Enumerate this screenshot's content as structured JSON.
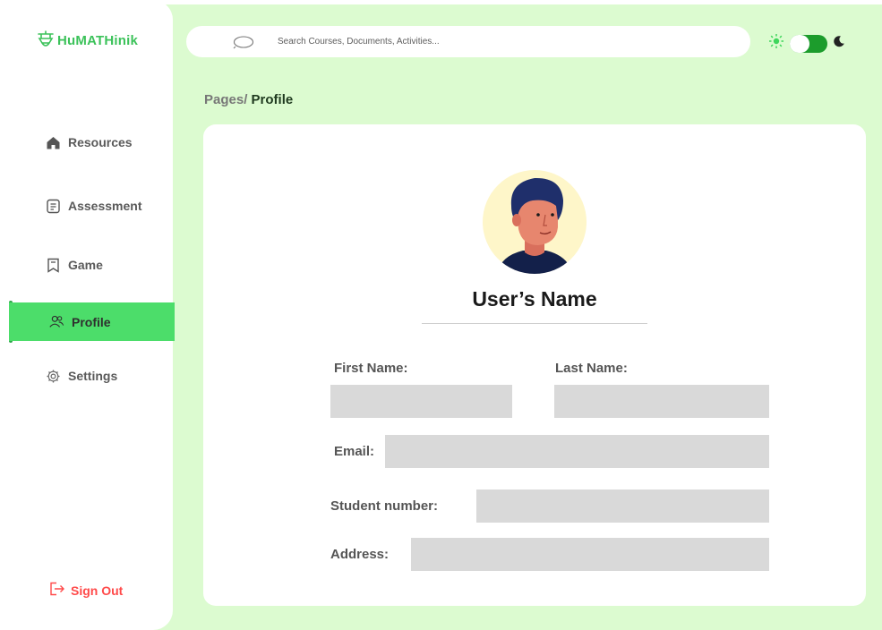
{
  "brand": {
    "name": "HuMATHinik",
    "color": "#3cc25a"
  },
  "sidebar": {
    "items": [
      {
        "label": "Resources",
        "icon": "home-icon"
      },
      {
        "label": "Assessment",
        "icon": "document-icon"
      },
      {
        "label": "Game",
        "icon": "bookmark-icon"
      },
      {
        "label": "Profile",
        "icon": "users-icon",
        "active": true
      },
      {
        "label": "Settings",
        "icon": "gear-icon"
      }
    ],
    "signout_label": "Sign Out",
    "active_color": "#4cdd6a"
  },
  "search": {
    "placeholder": "Search Courses, Documents, Activities..."
  },
  "theme_toggle": {
    "state": "dark",
    "icons": [
      "sun-icon",
      "moon-icon"
    ]
  },
  "breadcrumb": {
    "parent": "Pages/",
    "current": "Profile"
  },
  "profile": {
    "user_name": "User’s Name",
    "fields": {
      "first_name_label": "First Name:",
      "last_name_label": "Last Name:",
      "email_label": "Email:",
      "student_number_label": "Student number:",
      "address_label": "Address:"
    }
  },
  "colors": {
    "background": "#dcfbd0",
    "signout": "#ff4a4a",
    "toggle": "#1c9c2c"
  }
}
